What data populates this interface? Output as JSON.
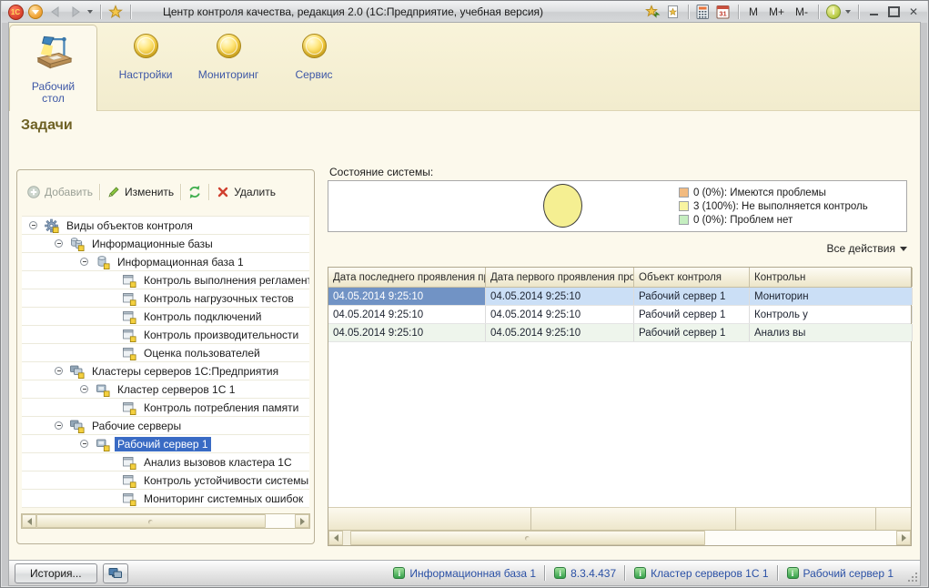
{
  "window": {
    "title": "Центр контроля качества, редакция 2.0  (1С:Предприятие, учебная версия)",
    "controls": {
      "m": "M",
      "m_plus": "M+",
      "m_minus": "M-"
    }
  },
  "tabs": {
    "desktop": "Рабочий стол",
    "settings": "Настройки",
    "monitoring": "Мониторинг",
    "service": "Сервис"
  },
  "page_title": "Задачи",
  "left_panel": {
    "toolbar": {
      "add": "Добавить",
      "edit": "Изменить",
      "del": "Удалить"
    },
    "tree": [
      {
        "label": "Виды объектов контроля",
        "level": 0,
        "icon": "gear",
        "expandable": true
      },
      {
        "label": "Информационные базы",
        "level": 1,
        "icon": "databases",
        "expandable": true
      },
      {
        "label": "Информационная база 1",
        "level": 2,
        "icon": "database",
        "expandable": true
      },
      {
        "label": "Контроль выполнения регламентных з...",
        "level": 3,
        "icon": "task"
      },
      {
        "label": "Контроль нагрузочных тестов",
        "level": 3,
        "icon": "task"
      },
      {
        "label": "Контроль подключений",
        "level": 3,
        "icon": "task"
      },
      {
        "label": "Контроль производительности",
        "level": 3,
        "icon": "task"
      },
      {
        "label": "Оценка пользователей",
        "level": 3,
        "icon": "task"
      },
      {
        "label": "Кластеры серверов 1С:Предприятия",
        "level": 1,
        "icon": "servers",
        "expandable": true
      },
      {
        "label": "Кластер серверов 1С 1",
        "level": 2,
        "icon": "server",
        "expandable": true
      },
      {
        "label": "Контроль потребления памяти",
        "level": 3,
        "icon": "task"
      },
      {
        "label": "Рабочие серверы",
        "level": 1,
        "icon": "servers",
        "expandable": true
      },
      {
        "label": "Рабочий сервер 1",
        "level": 2,
        "icon": "server",
        "expandable": true,
        "selected": true
      },
      {
        "label": "Анализ вызовов кластера 1С",
        "level": 3,
        "icon": "task"
      },
      {
        "label": "Контроль устойчивости системы",
        "level": 3,
        "icon": "task"
      },
      {
        "label": "Мониторинг системных ошибок",
        "level": 3,
        "icon": "task"
      }
    ]
  },
  "system_state": {
    "label": "Состояние системы:",
    "all_actions": "Все действия",
    "legend": [
      {
        "count_text": "0 (0%): Имеются проблемы",
        "color": "#f2bb80"
      },
      {
        "count_text": "3 (100%): Не выполняется контроль",
        "color": "#f8f4a0"
      },
      {
        "count_text": "0 (0%): Проблем нет",
        "color": "#c5eec0"
      }
    ],
    "chart": {
      "type": "pie",
      "slices": [
        {
          "label": "Имеются проблемы",
          "value": 0,
          "pct": 0,
          "color": "#f2bb80"
        },
        {
          "label": "Не выполняется контроль",
          "value": 3,
          "pct": 100,
          "color": "#f5ef92"
        },
        {
          "label": "Проблем нет",
          "value": 0,
          "pct": 0,
          "color": "#c5eec0"
        }
      ]
    }
  },
  "grid": {
    "columns": [
      {
        "label": "Дата последнего проявления проблемы"
      },
      {
        "label": "Дата первого проявления проблемы"
      },
      {
        "label": "Объект контроля"
      },
      {
        "label": "Контрольн"
      }
    ],
    "rows": [
      {
        "cells": [
          "04.05.2014 9:25:10",
          "04.05.2014 9:25:10",
          "Рабочий сервер 1",
          "Мониторин"
        ],
        "selected": true
      },
      {
        "cells": [
          "04.05.2014 9:25:10",
          "04.05.2014 9:25:10",
          "Рабочий сервер 1",
          "Контроль у"
        ]
      },
      {
        "cells": [
          "04.05.2014 9:25:10",
          "04.05.2014 9:25:10",
          "Рабочий сервер 1",
          "Анализ вы"
        ],
        "striped": true
      }
    ]
  },
  "statusbar": {
    "history": "История...",
    "items": [
      {
        "label": "Информационная база 1"
      },
      {
        "label": "8.3.4.437"
      },
      {
        "label": "Кластер серверов 1С 1"
      },
      {
        "label": "Рабочий сервер 1"
      }
    ]
  }
}
